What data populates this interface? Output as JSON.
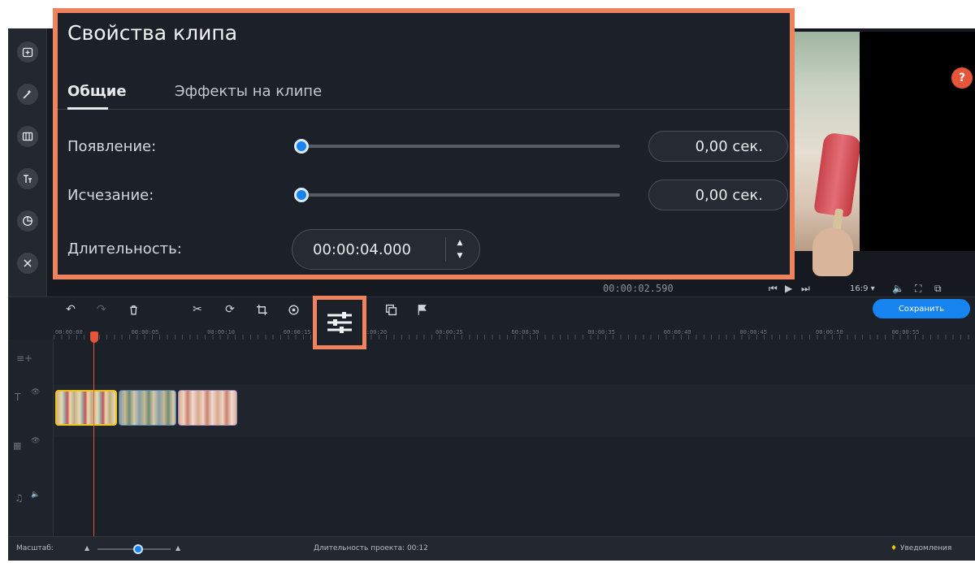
{
  "properties_panel": {
    "title": "Свойства клипа",
    "tabs": [
      {
        "label": "Общие",
        "active": true
      },
      {
        "label": "Эффекты на клипе",
        "active": false
      }
    ],
    "fade_in": {
      "label": "Появление:",
      "value": "0,00 сек.",
      "slider_fraction": 0.0
    },
    "fade_out": {
      "label": "Исчезание:",
      "value": "0,00 сек.",
      "slider_fraction": 0.0
    },
    "duration": {
      "label": "Длительность:",
      "value": "00:00:04.000"
    }
  },
  "sidebar": {
    "items": [
      {
        "icon": "import-icon"
      },
      {
        "icon": "filters-icon"
      },
      {
        "icon": "transitions-icon"
      },
      {
        "icon": "titles-icon"
      },
      {
        "icon": "stickers-icon"
      },
      {
        "icon": "more-tools-icon"
      }
    ]
  },
  "player": {
    "time": "00:00:02.590",
    "aspect_ratio": "16:9 ▾",
    "help_label": "?"
  },
  "timeline": {
    "save_label": "Сохранить",
    "ruler_ticks": [
      "00:00:00",
      "00:00:05",
      "00:00:10",
      "00:00:15",
      "00:00:20",
      "00:00:25",
      "00:00:30",
      "00:00:35",
      "00:00:40",
      "00:00:45",
      "00:00:50",
      "00:00:55"
    ]
  },
  "statusbar": {
    "scale_label": "Масштаб:",
    "project_duration": "Длительность проекта: 00:12",
    "notifications": "Уведомления"
  },
  "colors": {
    "accent": "#1683ee",
    "highlight": "#f0835e",
    "playhead": "#e5553a",
    "selected_clip": "#f0c419"
  }
}
